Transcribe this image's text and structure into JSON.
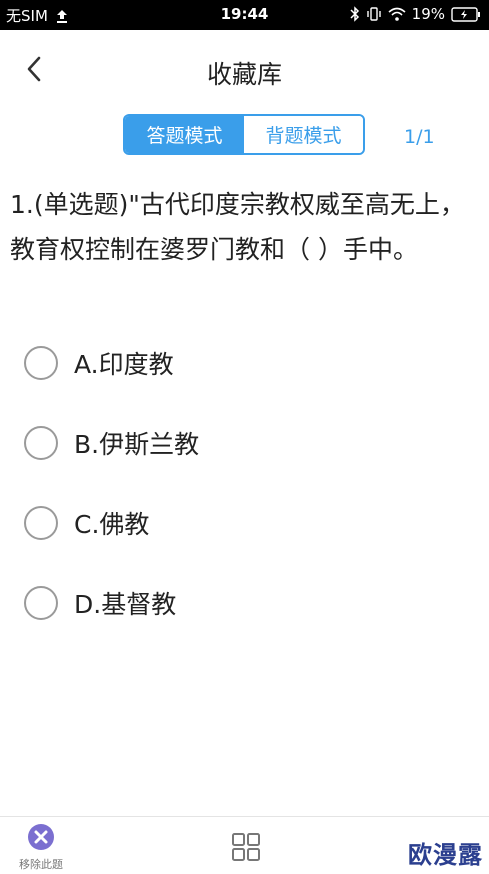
{
  "status_bar": {
    "carrier": "无SIM",
    "time": "19:44",
    "battery": "19%"
  },
  "header": {
    "title": "收藏库",
    "back_icon": "chevron-left-icon"
  },
  "mode_switch": {
    "tabs": [
      {
        "label": "答题模式",
        "active": true
      },
      {
        "label": "背题模式",
        "active": false
      }
    ]
  },
  "page_counter": "1/1",
  "question": {
    "text": "1.(单选题)\"古代印度宗教权威至高无上，教育权控制在婆罗门教和（ ）手中。",
    "options": [
      {
        "label": "A.印度教"
      },
      {
        "label": "B.伊斯兰教"
      },
      {
        "label": "C.佛教"
      },
      {
        "label": "D.基督教"
      }
    ]
  },
  "bottom_bar": {
    "remove_label": "移除此题",
    "remove_icon": "close-circle-icon",
    "grid_icon": "grid-icon",
    "watermark": "欧漫露"
  },
  "colors": {
    "accent": "#3a9eea",
    "remove_icon": "#7b6fd0",
    "watermark": "#2b3f8f"
  }
}
